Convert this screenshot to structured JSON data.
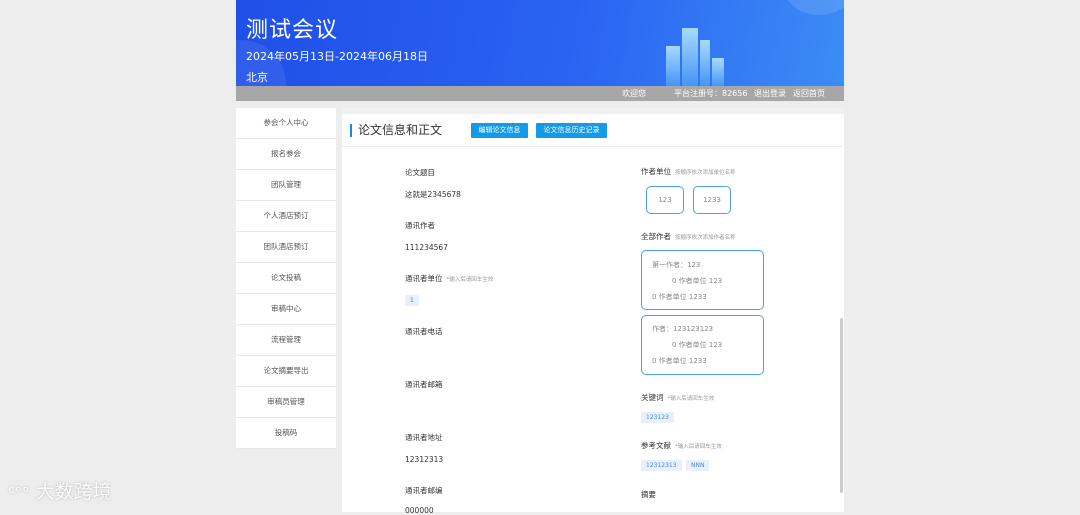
{
  "banner": {
    "title": "测试会议",
    "dates": "2024年05月13日-2024年06月18日",
    "city": "北京"
  },
  "infobar": {
    "welcome": "欢迎您",
    "reg_no": "平台注册号：82656",
    "logout": "退出登录",
    "home": "返回首页"
  },
  "sidebar": {
    "items": [
      {
        "label": "参会个人中心"
      },
      {
        "label": "报名参会"
      },
      {
        "label": "团队管理"
      },
      {
        "label": "个人酒店预订"
      },
      {
        "label": "团队酒店预订"
      },
      {
        "label": "论文投稿"
      },
      {
        "label": "审稿中心"
      },
      {
        "label": "流程管理"
      },
      {
        "label": "论文摘要导出"
      },
      {
        "label": "审稿员管理"
      },
      {
        "label": "投稿码"
      }
    ]
  },
  "main": {
    "section_title": "论文信息和正文",
    "edit_button": "编辑论文信息",
    "history_button": "论文信息历史记录",
    "left": {
      "title_label": "论文题目",
      "title_value": "这就是2345678",
      "corr_author_label": "通讯作者",
      "corr_author_value": "111234567",
      "corr_unit_label": "通讯者单位",
      "corr_unit_hint": "*输入后请回车生效",
      "corr_unit_tag": "1",
      "corr_phone_label": "通讯者电话",
      "corr_email_label": "通讯者邮箱",
      "corr_address_label": "通讯者地址",
      "corr_address_value": "12312313",
      "corr_zip_label": "通讯者邮编",
      "corr_zip_value": "000000"
    },
    "right": {
      "author_unit_label": "作者单位",
      "author_unit_hint": "按顺序依次添加单位名称",
      "units": [
        "123",
        "1233"
      ],
      "all_authors_label": "全部作者",
      "all_authors_hint": "按顺序依次添加作者名称",
      "authors": [
        {
          "name": "第一作者：123",
          "unit_index": "0 作者单位 123",
          "unit": "0 作者单位 1233"
        },
        {
          "name": "作者：123123123",
          "unit_index": "0 作者单位 123",
          "unit": "0 作者单位 1233"
        }
      ],
      "keywords_label": "关键词",
      "keywords_hint": "*输入后请回车生效",
      "keywords": [
        "123123"
      ],
      "refs_label": "参考文献",
      "refs_hint": "*输入后请回车生效",
      "refs": [
        "12312313",
        "NNN"
      ],
      "abstract_label": "摘要"
    }
  },
  "watermark": "大数跨境"
}
